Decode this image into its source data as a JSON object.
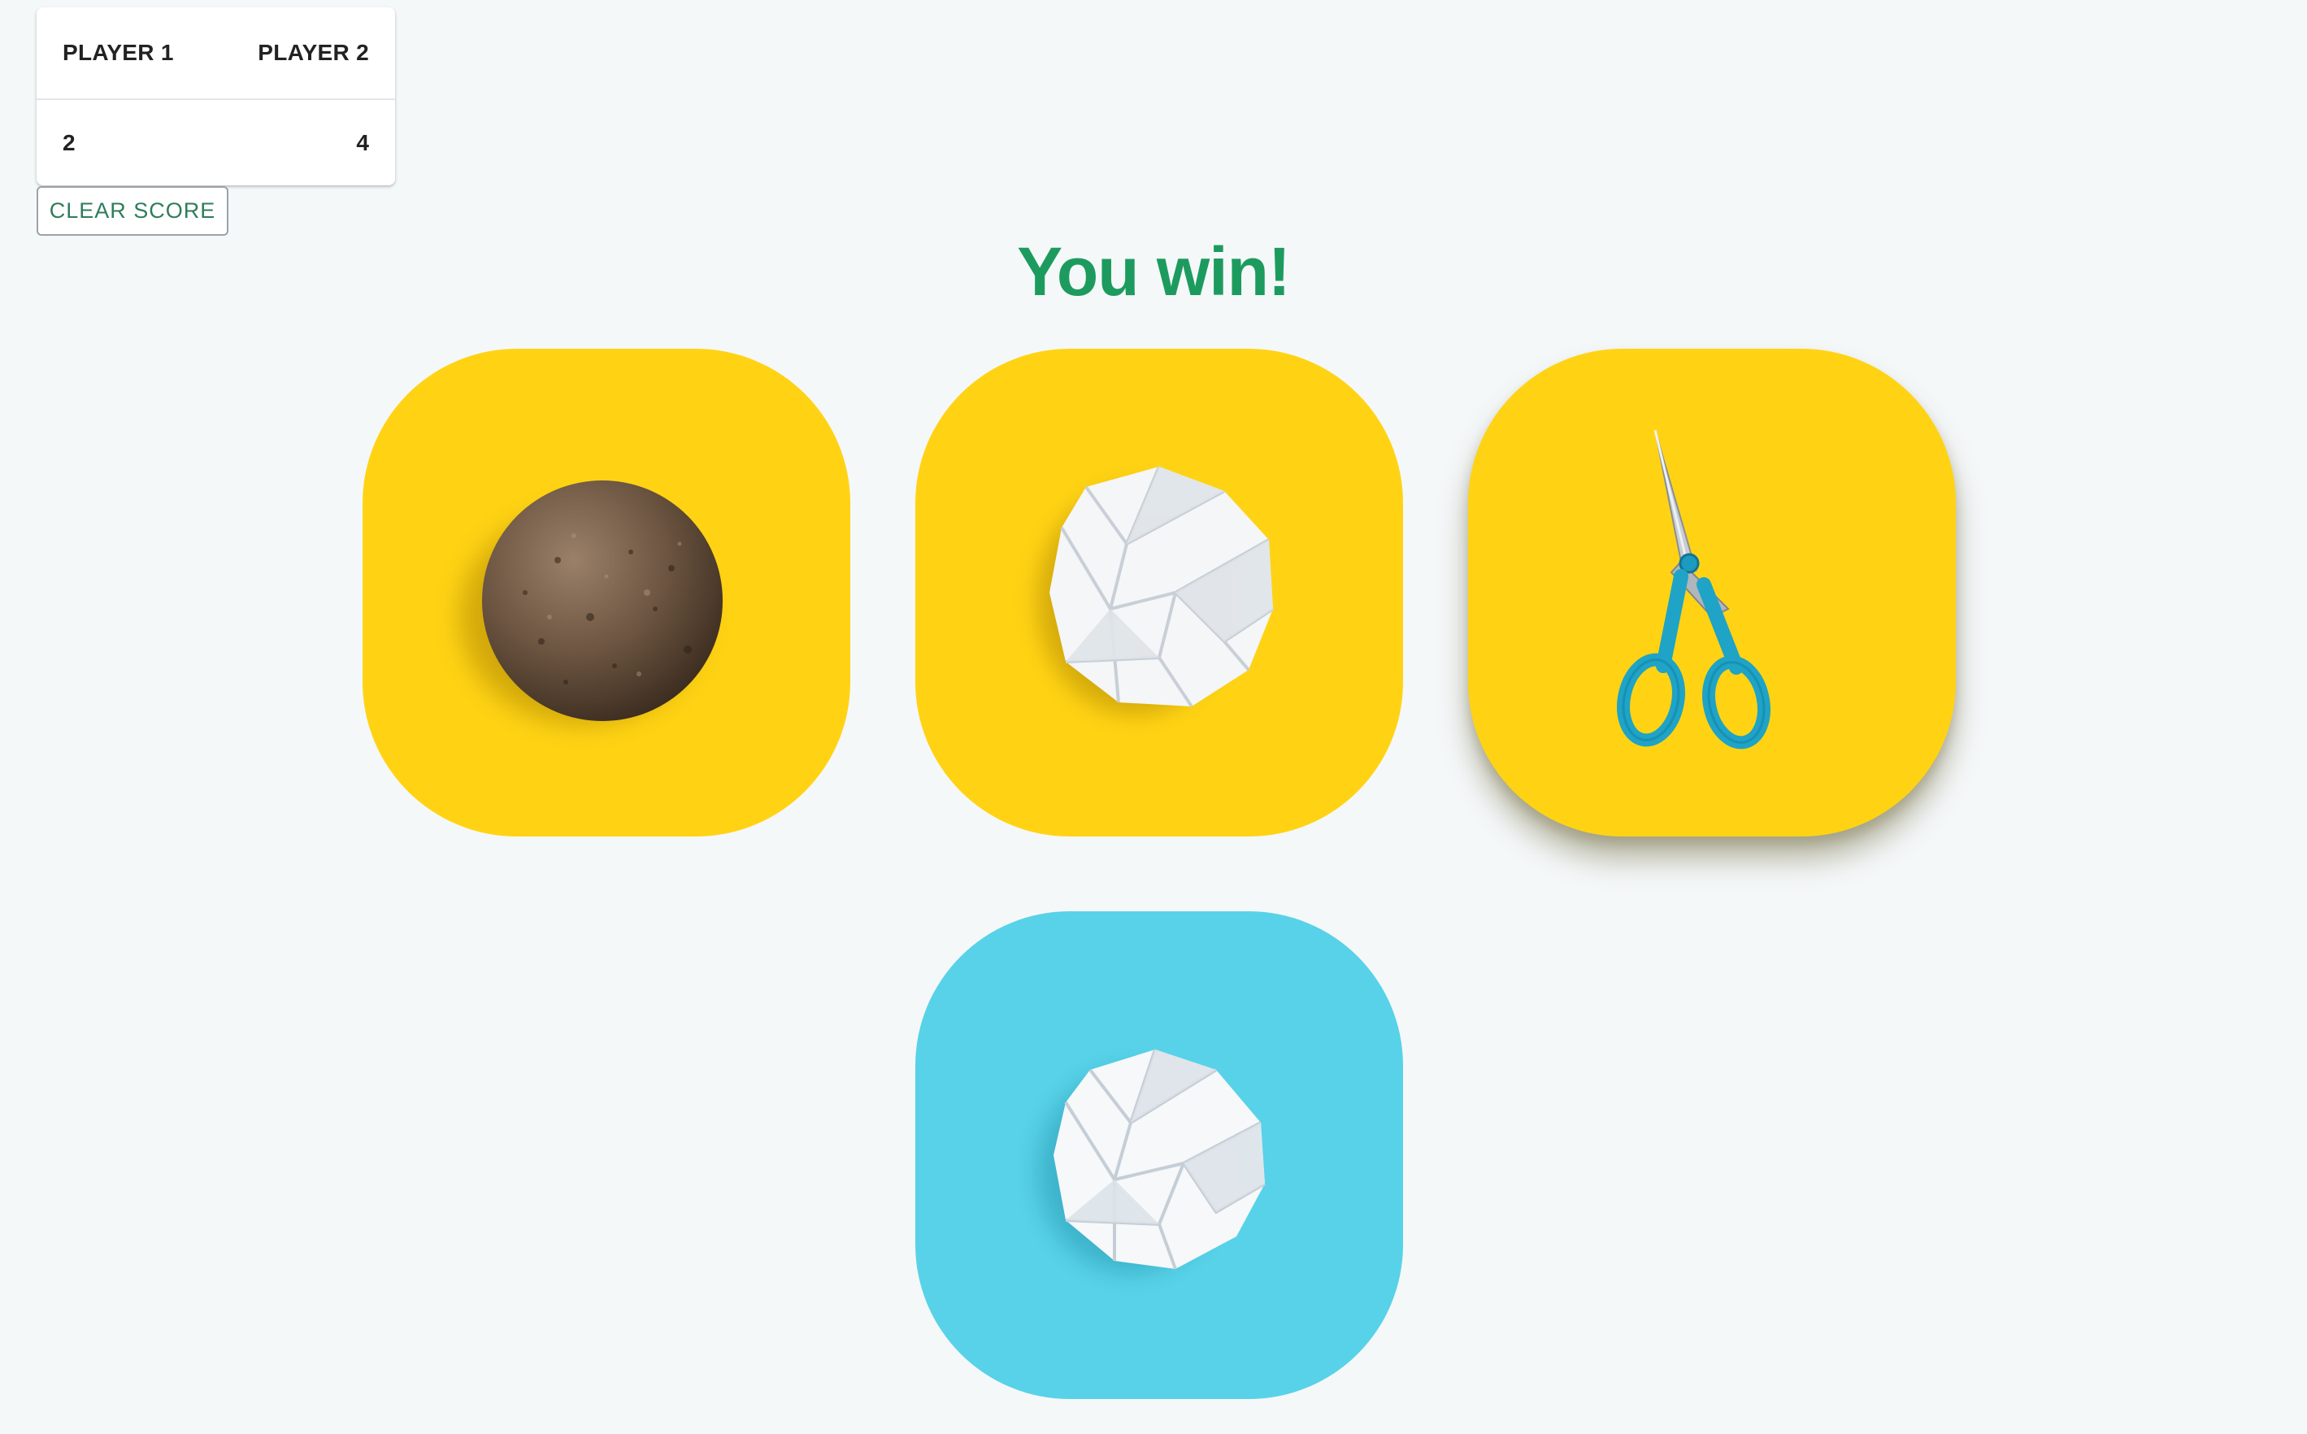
{
  "scoreboard": {
    "player1_label": "PLAYER 1",
    "player2_label": "PLAYER 2",
    "player1_score": "2",
    "player2_score": "4"
  },
  "clear_button_label": "CLEAR SCORE",
  "result_text": "You win!",
  "choices": [
    {
      "name": "rock",
      "icon": "rock-icon",
      "background": "#ffd314"
    },
    {
      "name": "paper",
      "icon": "paper-icon",
      "background": "#ffd314"
    },
    {
      "name": "scissors",
      "icon": "scissors-icon",
      "background": "#ffd314",
      "selected": true
    }
  ],
  "opponent_choice": {
    "name": "paper",
    "icon": "paper-icon",
    "background": "#58d2e8"
  },
  "colors": {
    "page_background": "#f5f8f9",
    "result_text": "#1d9b5f",
    "choice_card": "#ffd314",
    "opponent_card": "#58d2e8",
    "clear_button_text": "#2e7d5b"
  }
}
